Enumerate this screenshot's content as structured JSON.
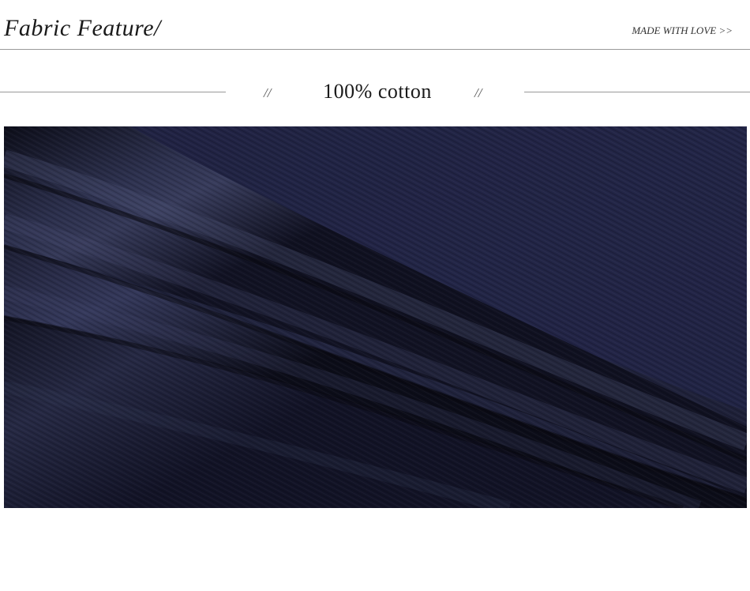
{
  "header": {
    "title": "Fabric Feature/",
    "tagline": "MADE WITH LOVE >>"
  },
  "feature": {
    "slash_left": "//",
    "label": "100% cotton",
    "slash_right": "//"
  },
  "photo": {
    "subject": "navy-cotton-fabric-folds",
    "colors": {
      "base": "#1f2138",
      "highlight": "#363a58",
      "shadow": "#0b0c17"
    }
  }
}
